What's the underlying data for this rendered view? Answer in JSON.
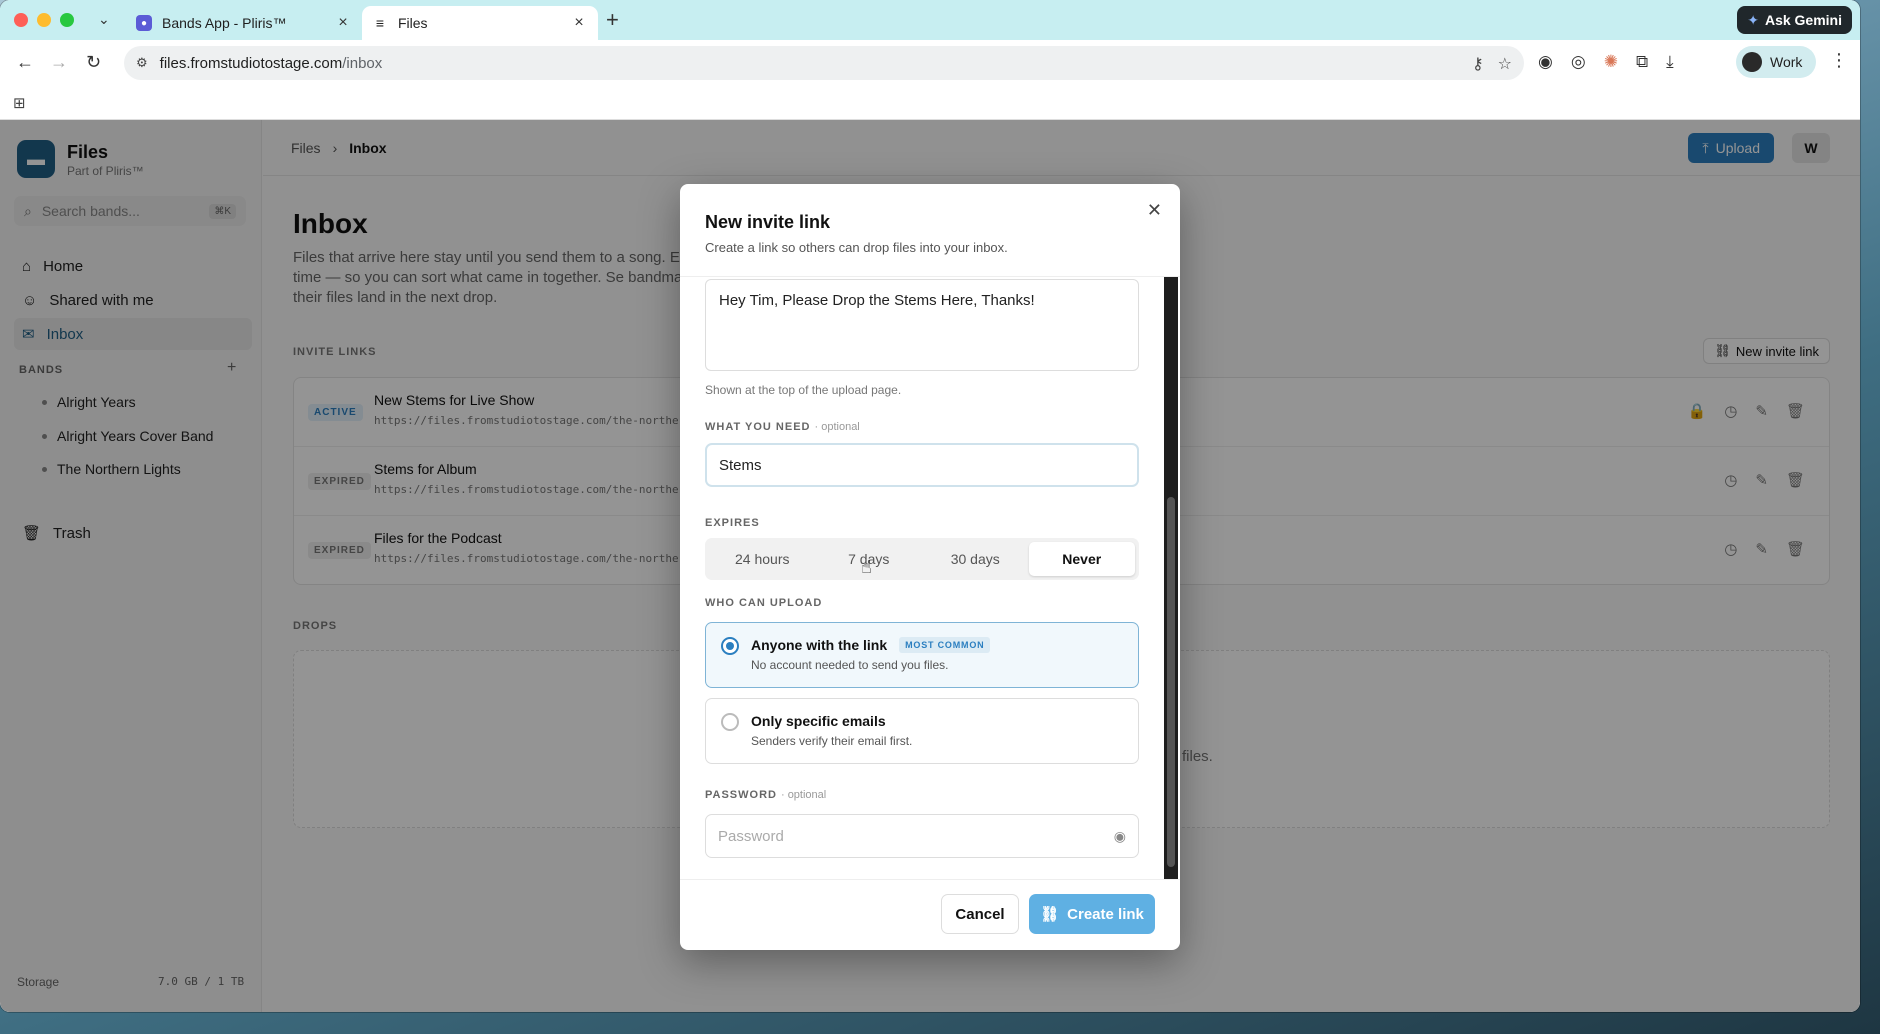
{
  "browser": {
    "tabs": [
      {
        "title": "Bands App - Pliris™"
      },
      {
        "title": "Files"
      }
    ],
    "new_tab": "+",
    "ask_gemini": "Ask Gemini",
    "url_host": "files.fromstudiotostage.com",
    "url_path": "/inbox",
    "profile_label": "Work"
  },
  "sidebar": {
    "app_name": "Files",
    "app_sub": "Part of Pliris™",
    "search_placeholder": "Search bands...",
    "search_shortcut": "⌘K",
    "nav": [
      {
        "label": "Home",
        "icon": "home-icon"
      },
      {
        "label": "Shared with me",
        "icon": "users-icon"
      },
      {
        "label": "Inbox",
        "icon": "mail-icon"
      }
    ],
    "bands_label": "BANDS",
    "bands": [
      "Alright Years",
      "Alright Years Cover Band",
      "The Northern Lights"
    ],
    "trash": "Trash",
    "storage_label": "Storage",
    "storage_value": "7.0 GB / 1 TB"
  },
  "main": {
    "breadcrumb_root": "Files",
    "breadcrumb_sep": "›",
    "breadcrumb_current": "Inbox",
    "upload_label": "Upload",
    "avatar_initial": "W",
    "title": "Inbox",
    "description": "Files that arrive here stay until you send them to a song. Ea date and time — so you can sort what came in together. Se bandmate and their files land in the next drop.",
    "invite_links_label": "INVITE LINKS",
    "new_invite_label": "New invite link",
    "links": [
      {
        "status": "ACTIVE",
        "name": "New Stems for Live Show",
        "url": "https://files.fromstudiotostage.com/the-northe"
      },
      {
        "status": "EXPIRED",
        "name": "Stems for Album",
        "url": "https://files.fromstudiotostage.com/the-northe"
      },
      {
        "status": "EXPIRED",
        "name": "Files for the Podcast",
        "url": "https://files.fromstudiotostage.com/the-northe"
      }
    ],
    "drops_label": "DROPS",
    "drops_tail": "files."
  },
  "modal": {
    "title": "New invite link",
    "subtitle": "Create a link so others can drop files into your inbox.",
    "message_value": "Hey Tim, Please Drop the Stems Here, Thanks!",
    "message_hint": "Shown at the top of the upload page.",
    "need_label": "WHAT YOU NEED",
    "optional": "· optional",
    "need_value": "Stems",
    "expires_label": "EXPIRES",
    "expires_options": [
      "24 hours",
      "7 days",
      "30 days",
      "Never"
    ],
    "expires_selected": "Never",
    "who_label": "WHO CAN UPLOAD",
    "who_options": [
      {
        "title": "Anyone with the link",
        "badge": "MOST COMMON",
        "desc": "No account needed to send you files.",
        "selected": true
      },
      {
        "title": "Only specific emails",
        "desc": "Senders verify their email first.",
        "selected": false
      }
    ],
    "password_label": "PASSWORD",
    "password_placeholder": "Password",
    "cancel_label": "Cancel",
    "create_label": "Create link"
  },
  "colors": {
    "accent": "#2b7fc0",
    "create_button": "#5fb0e3",
    "tabstrip": "#c7eef1"
  }
}
